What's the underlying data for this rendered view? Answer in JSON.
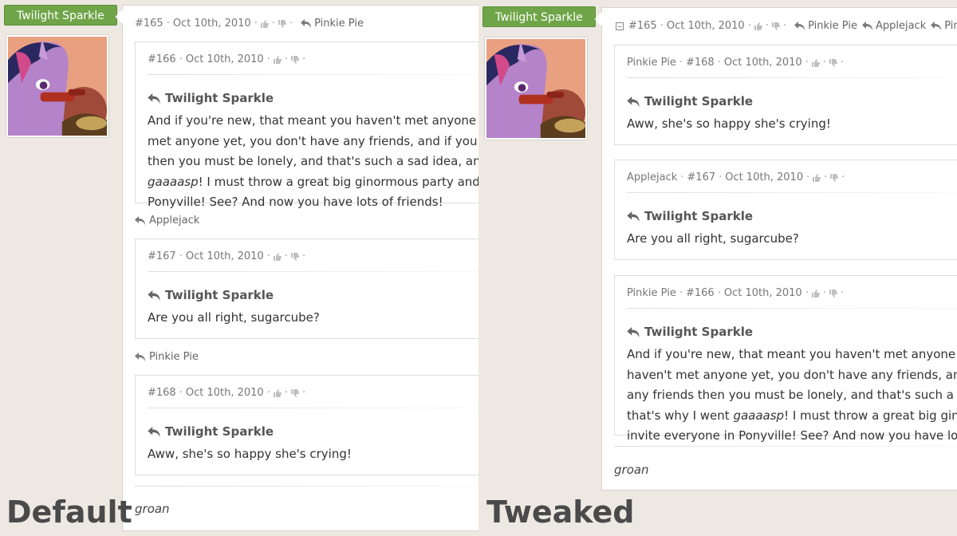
{
  "default": {
    "label": "Default",
    "user_name": "Twilight Sparkle",
    "post": {
      "id": "#165",
      "date": "Oct 10th, 2010",
      "reply_to": [
        "Pinkie Pie"
      ],
      "final_text": "groan"
    },
    "quotes": [
      {
        "id": "#166",
        "date": "Oct 10th, 2010",
        "author": "Twilight Sparkle",
        "text_a": "And if you're new, that meant you haven't met anyone yet, and if you haven't met anyone yet, you don't have any friends, and if you don't have any friends then you must be lonely, and that's such a sad idea, and that's why I went ",
        "text_em": "gaaaasp",
        "text_b": "! I must throw a great big ginormous party and invite everyone in Ponyville! See? And now you have lots of friends!"
      },
      {
        "between_author": "Applejack",
        "id": "#167",
        "date": "Oct 10th, 2010",
        "author": "Twilight Sparkle",
        "text": "Are you all right, sugarcube?"
      },
      {
        "between_author": "Pinkie Pie",
        "id": "#168",
        "date": "Oct 10th, 2010",
        "author": "Twilight Sparkle",
        "text": "Aww, she's so happy she's crying!"
      }
    ]
  },
  "tweaked": {
    "label": "Tweaked",
    "user_name": "Twilight Sparkle",
    "post": {
      "id": "#165",
      "date": "Oct 10th, 2010",
      "reply_to": [
        "Pinkie Pie",
        "Applejack",
        "Pinkie Pie"
      ],
      "final_text": "groan"
    },
    "quotes": [
      {
        "source": "Pinkie Pie",
        "id": "#168",
        "date": "Oct 10th, 2010",
        "author": "Twilight Sparkle",
        "text": "Aww, she's so happy she's crying!"
      },
      {
        "source": "Applejack",
        "id": "#167",
        "date": "Oct 10th, 2010",
        "author": "Twilight Sparkle",
        "text": "Are you all right, sugarcube?"
      },
      {
        "source": "Pinkie Pie",
        "id": "#166",
        "date": "Oct 10th, 2010",
        "author": "Twilight Sparkle",
        "text_a": "And if you're new, that meant you haven't met anyone yet, and if you haven't met anyone yet, you don't have any friends, and if you don't have any friends then you must be lonely, and that's such a sad idea, and that's why I went ",
        "text_em": "gaaaasp",
        "text_b": "! I must throw a great big ginormous party and invite everyone in Ponyville! See? And now you have lots of friends!"
      }
    ]
  },
  "colors": {
    "page_bg": "#ede8e2",
    "name_tag": "#6fa548",
    "card_bg": "#ffffff"
  }
}
